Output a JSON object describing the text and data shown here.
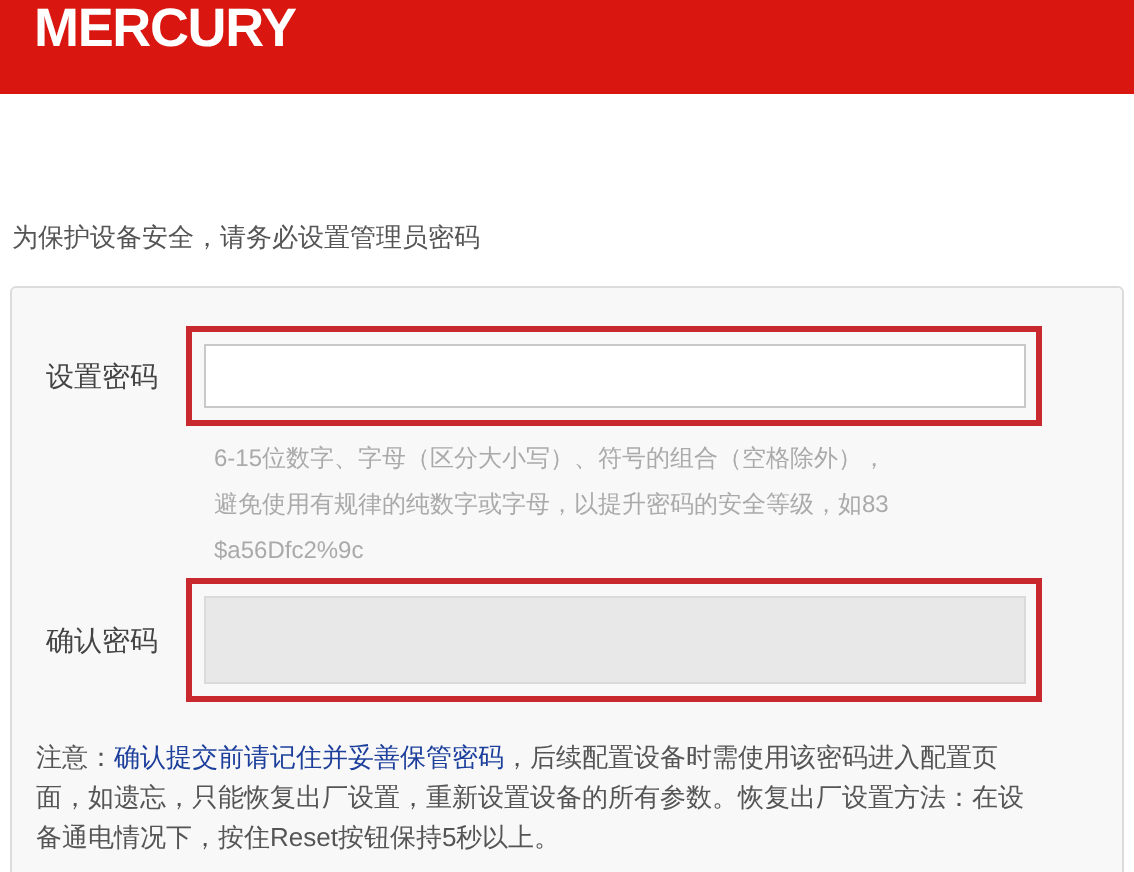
{
  "header": {
    "logo": "MERCURY"
  },
  "instruction": "为保护设备安全，请务必设置管理员密码",
  "fields": [
    {
      "label": "设置密码",
      "disabled": false,
      "highlighted": true
    },
    {
      "label": "确认密码",
      "disabled": true,
      "highlighted": true
    }
  ],
  "hint_lines": [
    "6-15位数字、字母（区分大小写）、符号的组合（空格除外），",
    "避免使用有规律的纯数字或字母，以提升密码的安全等级，如83",
    "$a56Dfc2%9c"
  ],
  "note": {
    "prefix": "注意：",
    "link": "确认提交前请记住并妥善保管密码",
    "rest": "，后续配置设备时需使用该密码进入配置页面，如遗忘，只能恢复出厂设置，重新设置设备的所有参数。恢复出厂设置方法：在设备通电情况下，按住Reset按钮保持5秒以上。"
  }
}
